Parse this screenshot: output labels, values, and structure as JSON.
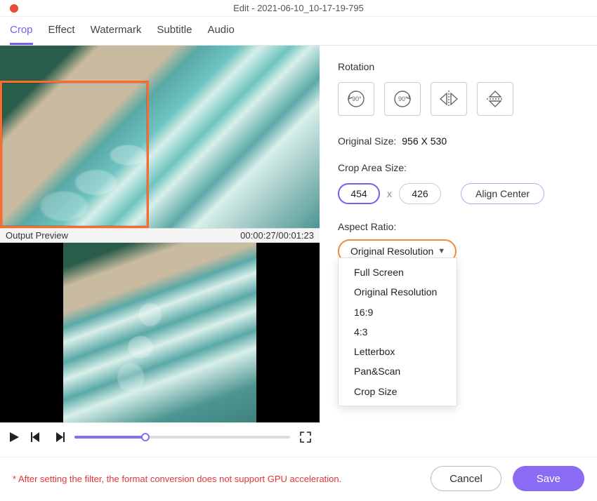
{
  "window": {
    "title": "Edit - 2021-06-10_10-17-19-795"
  },
  "tabs": {
    "items": [
      "Crop",
      "Effect",
      "Watermark",
      "Subtitle",
      "Audio"
    ],
    "active": "Crop"
  },
  "preview": {
    "label": "Output Preview",
    "time": "00:00:27/00:01:23",
    "progress_pct": 33
  },
  "rotation": {
    "label": "Rotation",
    "buttons": [
      "rotate-left-90",
      "rotate-right-90",
      "flip-horizontal",
      "flip-vertical"
    ]
  },
  "original_size": {
    "label": "Original Size:",
    "value": "956 X 530"
  },
  "crop_area": {
    "label": "Crop Area Size:",
    "width": "454",
    "height": "426",
    "sep": "x",
    "align_label": "Align Center"
  },
  "aspect_ratio": {
    "label": "Aspect Ratio:",
    "selected": "Original Resolution",
    "options": [
      "Full Screen",
      "Original Resolution",
      "16:9",
      "4:3",
      "Letterbox",
      "Pan&Scan",
      "Crop Size"
    ]
  },
  "footnote": "* After setting the filter, the format conversion does not support GPU acceleration.",
  "buttons": {
    "cancel": "Cancel",
    "save": "Save"
  },
  "colors": {
    "accent": "#8a6cf3",
    "highlight_border": "#f08a3c",
    "crop_border": "#ff6a2b",
    "danger_text": "#e03636"
  }
}
